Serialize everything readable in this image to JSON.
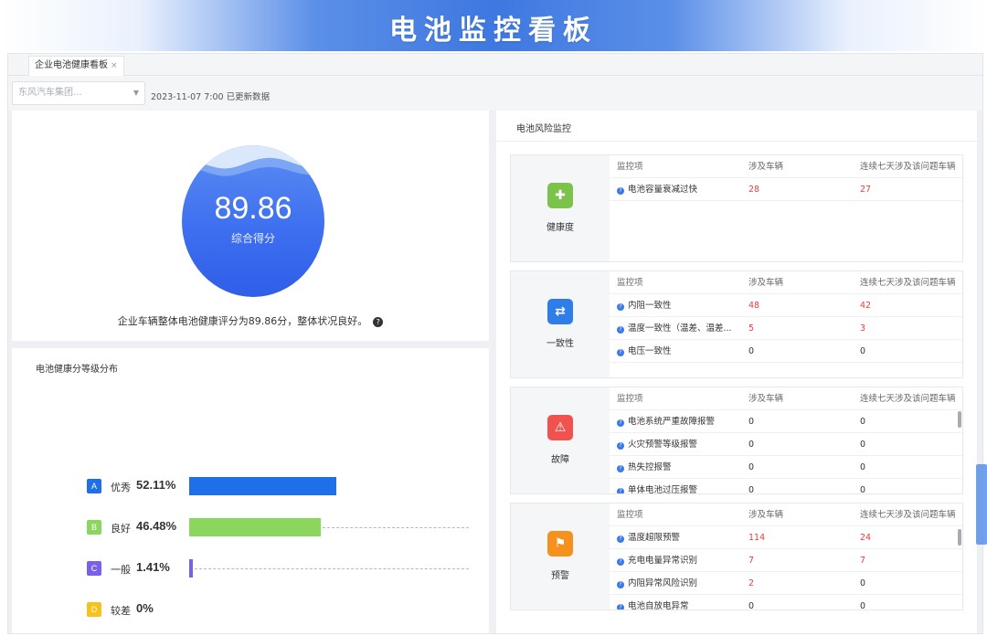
{
  "banner": {
    "title": "电池监控看板"
  },
  "tabbar": {
    "active_tab": "企业电池健康看板",
    "close": "×"
  },
  "toolbar": {
    "select_placeholder": "东风汽车集团...",
    "update_text": "2023-11-07 7:00 已更新数据"
  },
  "score": {
    "value": "89.86",
    "label": "综合得分",
    "description": "企业车辆整体电池健康评分为89.86分，整体状况良好。",
    "help": "?"
  },
  "distribution": {
    "title": "电池健康分等级分布",
    "rows": [
      {
        "badge": "A",
        "name": "优秀",
        "pct_label": "52.11%",
        "value": 52.11,
        "color": "#1f6fe8"
      },
      {
        "badge": "B",
        "name": "良好",
        "pct_label": "46.48%",
        "value": 46.48,
        "color": "#8bd65c"
      },
      {
        "badge": "C",
        "name": "一般",
        "pct_label": "1.41%",
        "value": 1.41,
        "color": "#7b61e8"
      },
      {
        "badge": "D",
        "name": "较差",
        "pct_label": "0%",
        "value": 0,
        "color": "#f7c21a"
      }
    ],
    "max_value": 100
  },
  "risk": {
    "title": "电池风险监控",
    "cards": [
      {
        "label": "健康度",
        "icon": "shield-icon",
        "icon_glyph": "✚",
        "color": "#7bc34a",
        "headers": [
          "监控项",
          "涉及车辆",
          "连续七天涉及该问题车辆"
        ],
        "rows": [
          {
            "item": "电池容量衰减过快",
            "vehicles": "28",
            "vehicles_red": true,
            "seven_days": "27",
            "seven_days_red": true
          }
        ]
      },
      {
        "label": "一致性",
        "icon": "consistency-icon",
        "icon_glyph": "⇄",
        "color": "#2f7de8",
        "headers": [
          "监控项",
          "涉及车辆",
          "连续七天涉及该问题车辆"
        ],
        "rows": [
          {
            "item": "内阻一致性",
            "vehicles": "48",
            "vehicles_red": true,
            "seven_days": "42",
            "seven_days_red": true
          },
          {
            "item": "温度一致性（温差、温差...",
            "vehicles": "5",
            "vehicles_red": true,
            "seven_days": "3",
            "seven_days_red": true
          },
          {
            "item": "电压一致性",
            "vehicles": "0",
            "vehicles_red": false,
            "seven_days": "0",
            "seven_days_red": false
          }
        ]
      },
      {
        "label": "故障",
        "icon": "warning-icon",
        "icon_glyph": "⚠",
        "color": "#f0524f",
        "headers": [
          "监控项",
          "涉及车辆",
          "连续七天涉及该问题车辆"
        ],
        "rows": [
          {
            "item": "电池系统严重故障报警",
            "vehicles": "0",
            "vehicles_red": false,
            "seven_days": "0",
            "seven_days_red": false
          },
          {
            "item": "火灾预警等级报警",
            "vehicles": "0",
            "vehicles_red": false,
            "seven_days": "0",
            "seven_days_red": false
          },
          {
            "item": "热失控报警",
            "vehicles": "0",
            "vehicles_red": false,
            "seven_days": "0",
            "seven_days_red": false
          },
          {
            "item": "单体电池过压报警",
            "vehicles": "0",
            "vehicles_red": false,
            "seven_days": "0",
            "seven_days_red": false
          }
        ]
      },
      {
        "label": "预警",
        "icon": "alert-icon",
        "icon_glyph": "⚑",
        "color": "#f5921e",
        "headers": [
          "监控项",
          "涉及车辆",
          "连续七天涉及该问题车辆"
        ],
        "rows": [
          {
            "item": "温度超限预警",
            "vehicles": "114",
            "vehicles_red": true,
            "seven_days": "24",
            "seven_days_red": true
          },
          {
            "item": "充电电量异常识别",
            "vehicles": "7",
            "vehicles_red": true,
            "seven_days": "7",
            "seven_days_red": true
          },
          {
            "item": "内阻异常风险识别",
            "vehicles": "2",
            "vehicles_red": true,
            "seven_days": "0",
            "seven_days_red": false
          },
          {
            "item": "电池自放电异常",
            "vehicles": "0",
            "vehicles_red": false,
            "seven_days": "0",
            "seven_days_red": false
          }
        ]
      }
    ]
  }
}
